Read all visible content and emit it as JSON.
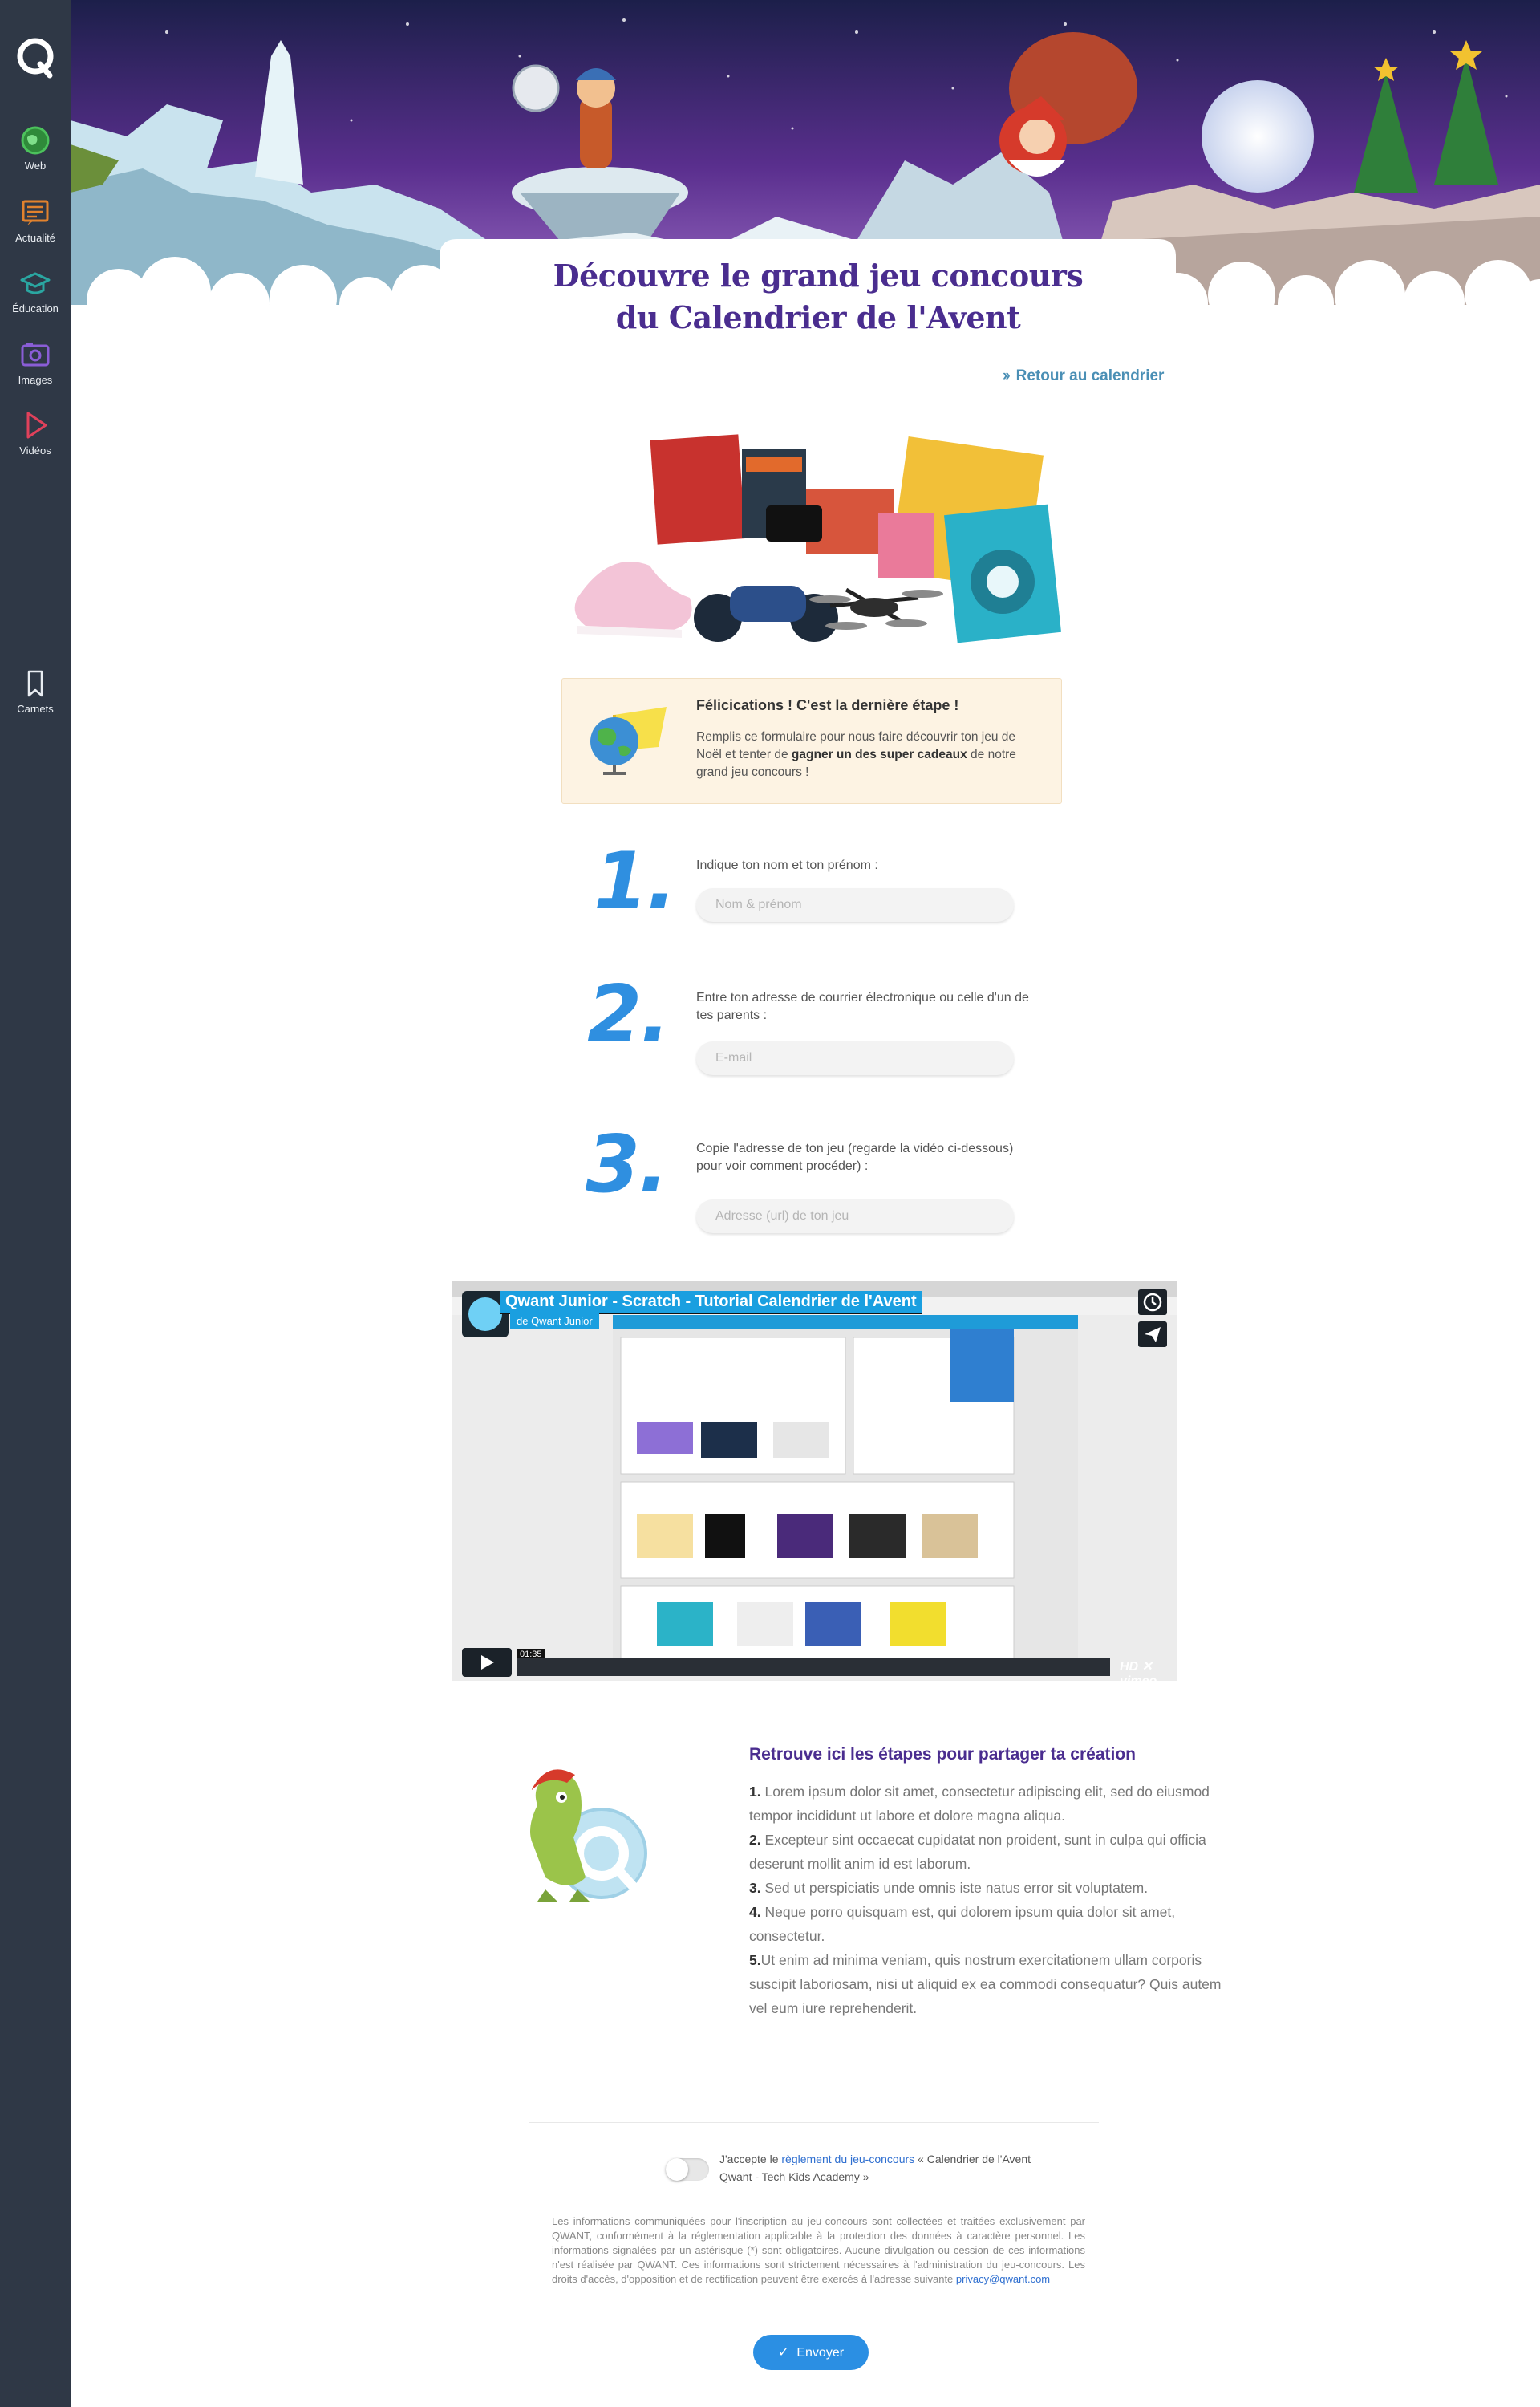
{
  "sidebar": {
    "items": [
      {
        "label": "Web",
        "icon": "web-icon"
      },
      {
        "label": "Actualité",
        "icon": "news-icon"
      },
      {
        "label": "Éducation",
        "icon": "education-icon"
      },
      {
        "label": "Images",
        "icon": "images-icon"
      },
      {
        "label": "Vidéos",
        "icon": "videos-icon"
      },
      {
        "label": "Carnets",
        "icon": "bookmark-icon"
      }
    ],
    "colors": {
      "background": "#2f3846",
      "web": "#3aa34a",
      "news": "#e2822d",
      "education": "#2aa6a1",
      "images": "#8a5dd6",
      "videos": "#e0415b"
    }
  },
  "page": {
    "title_line1": "Découvre le grand jeu concours",
    "title_line2": "du Calendrier de l'Avent",
    "back_link": "Retour au calendrier"
  },
  "notice": {
    "title": "Félicications ! C'est la dernière étape !",
    "text_before": "Remplis ce formulaire pour nous faire découvrir ton jeu de Noël et tenter de ",
    "text_bold": "gagner un des super cadeaux",
    "text_after": " de notre grand jeu concours !"
  },
  "steps": [
    {
      "number": "1.",
      "label": "Indique ton nom et ton prénom :",
      "placeholder": "Nom & prénom",
      "value": ""
    },
    {
      "number": "2.",
      "label": "Entre ton adresse de courrier électronique ou celle d'un de tes parents :",
      "placeholder": "E-mail",
      "value": ""
    },
    {
      "number": "3.",
      "label": "Copie l'adresse de ton jeu (regarde la vidéo ci-dessous) pour voir comment procéder) :",
      "placeholder": "Adresse (url) de ton jeu",
      "value": ""
    }
  ],
  "video": {
    "title": "Qwant Junior - Scratch - Tutorial Calendrier de l'Avent",
    "subtitle": "de Qwant Junior",
    "time": "01:35",
    "progress": 0,
    "hd": "HD",
    "brand": "vimeo"
  },
  "share": {
    "title": "Retrouve ici les étapes pour partager ta création",
    "steps": [
      {
        "num": "1.",
        "text": " Lorem ipsum dolor sit amet, consectetur adipiscing elit, sed do eiusmod tempor incididunt ut labore et dolore magna aliqua."
      },
      {
        "num": "2.",
        "text": " Excepteur sint occaecat cupidatat non proident, sunt in culpa qui officia deserunt mollit anim id est laborum."
      },
      {
        "num": "3.",
        "text": " Sed ut perspiciatis unde omnis iste natus error sit voluptatem."
      },
      {
        "num": "4.",
        "text": " Neque porro quisquam est, qui dolorem ipsum quia dolor sit amet, consectetur."
      },
      {
        "num": "5.",
        "text": "Ut enim ad minima veniam, quis nostrum exercitationem ullam corporis suscipit laboriosam, nisi ut aliquid ex ea commodi consequatur? Quis autem vel eum iure reprehenderit."
      }
    ]
  },
  "consent": {
    "prefix": "J'accepte le ",
    "link": "règlement du jeu-concours",
    "suffix": " « Calendrier de l'Avent Qwant - Tech Kids Academy »",
    "checked": false
  },
  "legal": {
    "text": "Les informations communiquées pour l'inscription au jeu-concours sont collectées et traitées exclusivement par QWANT, conformément à la réglementation applicable à la protection des données à caractère personnel. Les informations signalées par un astérisque (*) sont obligatoires. Aucune divulgation ou cession de ces informations n'est réalisée par QWANT. Ces informations sont strictement nécessaires à l'administration du jeu-concours. Les droits d'accès, d'opposition et de rectification peuvent être exercés à l'adresse suivante ",
    "email": "privacy@qwant.com"
  },
  "submit": {
    "label": "Envoyer"
  },
  "colors": {
    "title": "#4a2d8f",
    "accent": "#2b8fe3",
    "step_number": "#2f8fe0",
    "link": "#4a8fb5",
    "notice_bg": "#fdf3e3"
  }
}
